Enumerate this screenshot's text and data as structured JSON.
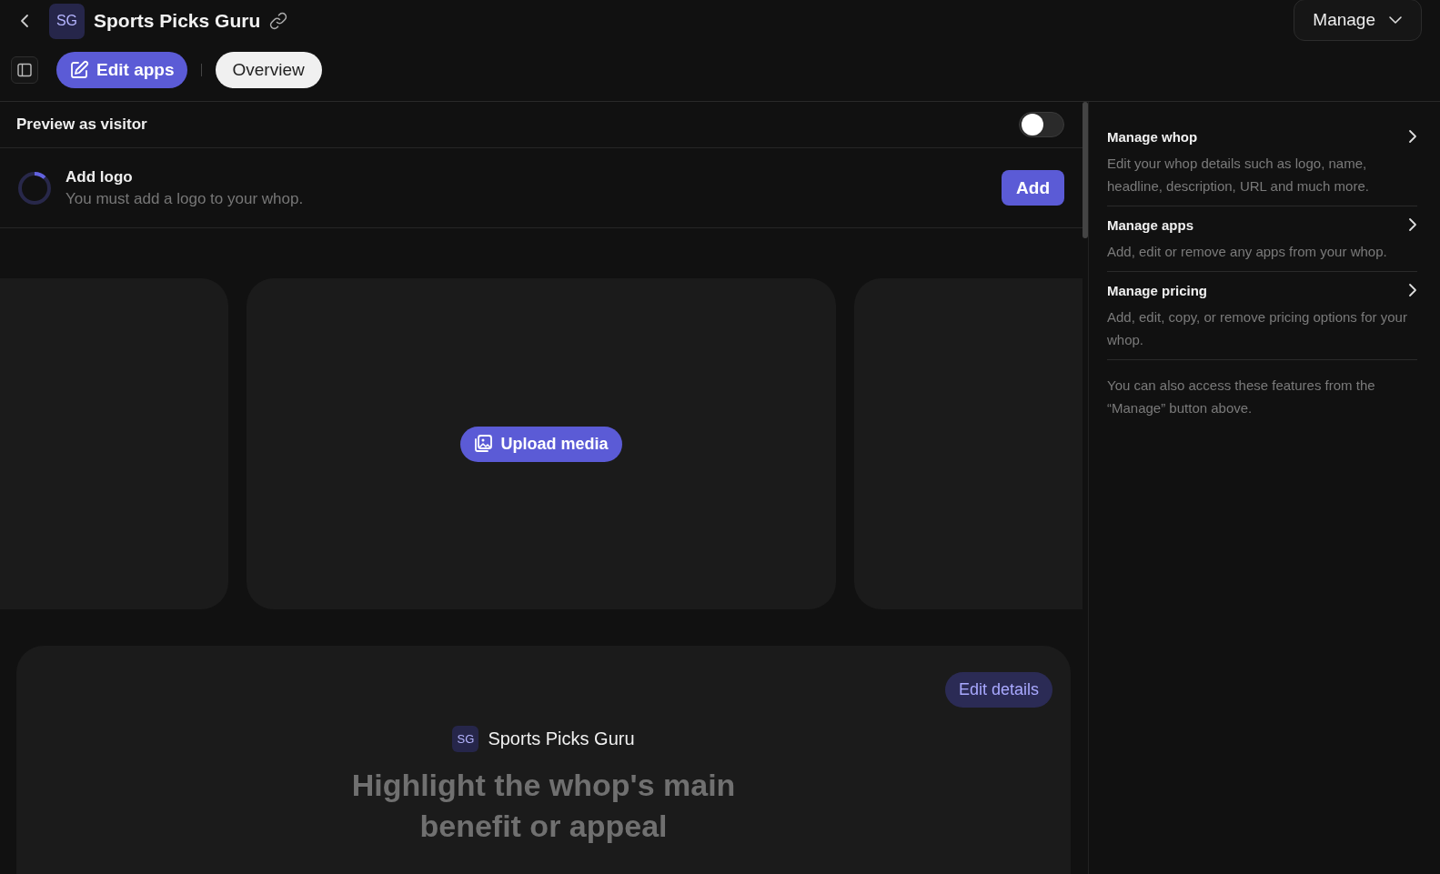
{
  "header": {
    "avatar": "SG",
    "title": "Sports Picks Guru",
    "manage_button": "Manage"
  },
  "toolbar": {
    "tabs": [
      {
        "label": "Edit apps",
        "selected": true,
        "kind": "edit"
      },
      {
        "label": "Overview",
        "selected": false,
        "kind": "plain"
      }
    ]
  },
  "preview": {
    "label": "Preview as visitor",
    "on": false
  },
  "task": {
    "title": "Add logo",
    "subtitle": "You must add a logo to your whop.",
    "level": 0.12,
    "button": "Add"
  },
  "carousel": {
    "button": "Upload media"
  },
  "hero": {
    "edit_button": "Edit details",
    "avatar": "SG",
    "name": "Sports Picks Guru",
    "headline": "Highlight the whop's main benefit or appeal"
  },
  "side_panel": {
    "items": [
      {
        "title": "Manage whop",
        "description": "Edit your whop details such as logo, name, headline, description, URL and much more."
      },
      {
        "title": "Manage apps",
        "description": "Add, edit or remove any apps from your whop."
      },
      {
        "title": "Manage pricing",
        "description": "Add, edit, copy, or remove pricing options for your whop."
      }
    ],
    "note": "You can also access these features from the “Manage” button above."
  }
}
